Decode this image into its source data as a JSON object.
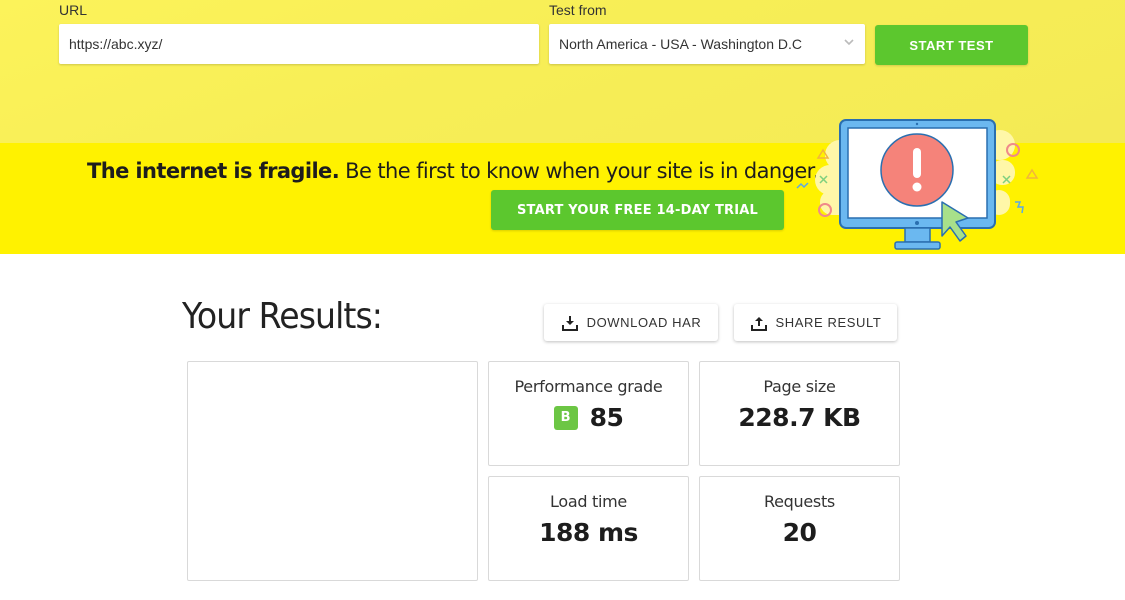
{
  "test_form": {
    "url_label": "URL",
    "url_value": "https://abc.xyz/",
    "location_label": "Test from",
    "location_value": "North America - USA - Washington D.C",
    "start_button": "START TEST"
  },
  "banner": {
    "headline_bold": "The internet is fragile.",
    "headline_rest": " Be the first to know when your site is in danger.",
    "cta_button": "START YOUR FREE 14-DAY TRIAL",
    "illustration": "monitor-alert-illustration"
  },
  "results": {
    "title": "Your Results:",
    "download_button": "DOWNLOAD HAR",
    "share_button": "SHARE RESULT",
    "metrics": [
      {
        "label": "Performance grade",
        "grade": "B",
        "value": "85"
      },
      {
        "label": "Page size",
        "value": "228.7 KB"
      },
      {
        "label": "Load time",
        "value": "188 ms"
      },
      {
        "label": "Requests",
        "value": "20"
      }
    ]
  },
  "colors": {
    "accent_green": "#5cc72e",
    "grade_green": "#6cc644",
    "banner_yellow": "#fff200",
    "top_yellow": "#f7ee56"
  }
}
